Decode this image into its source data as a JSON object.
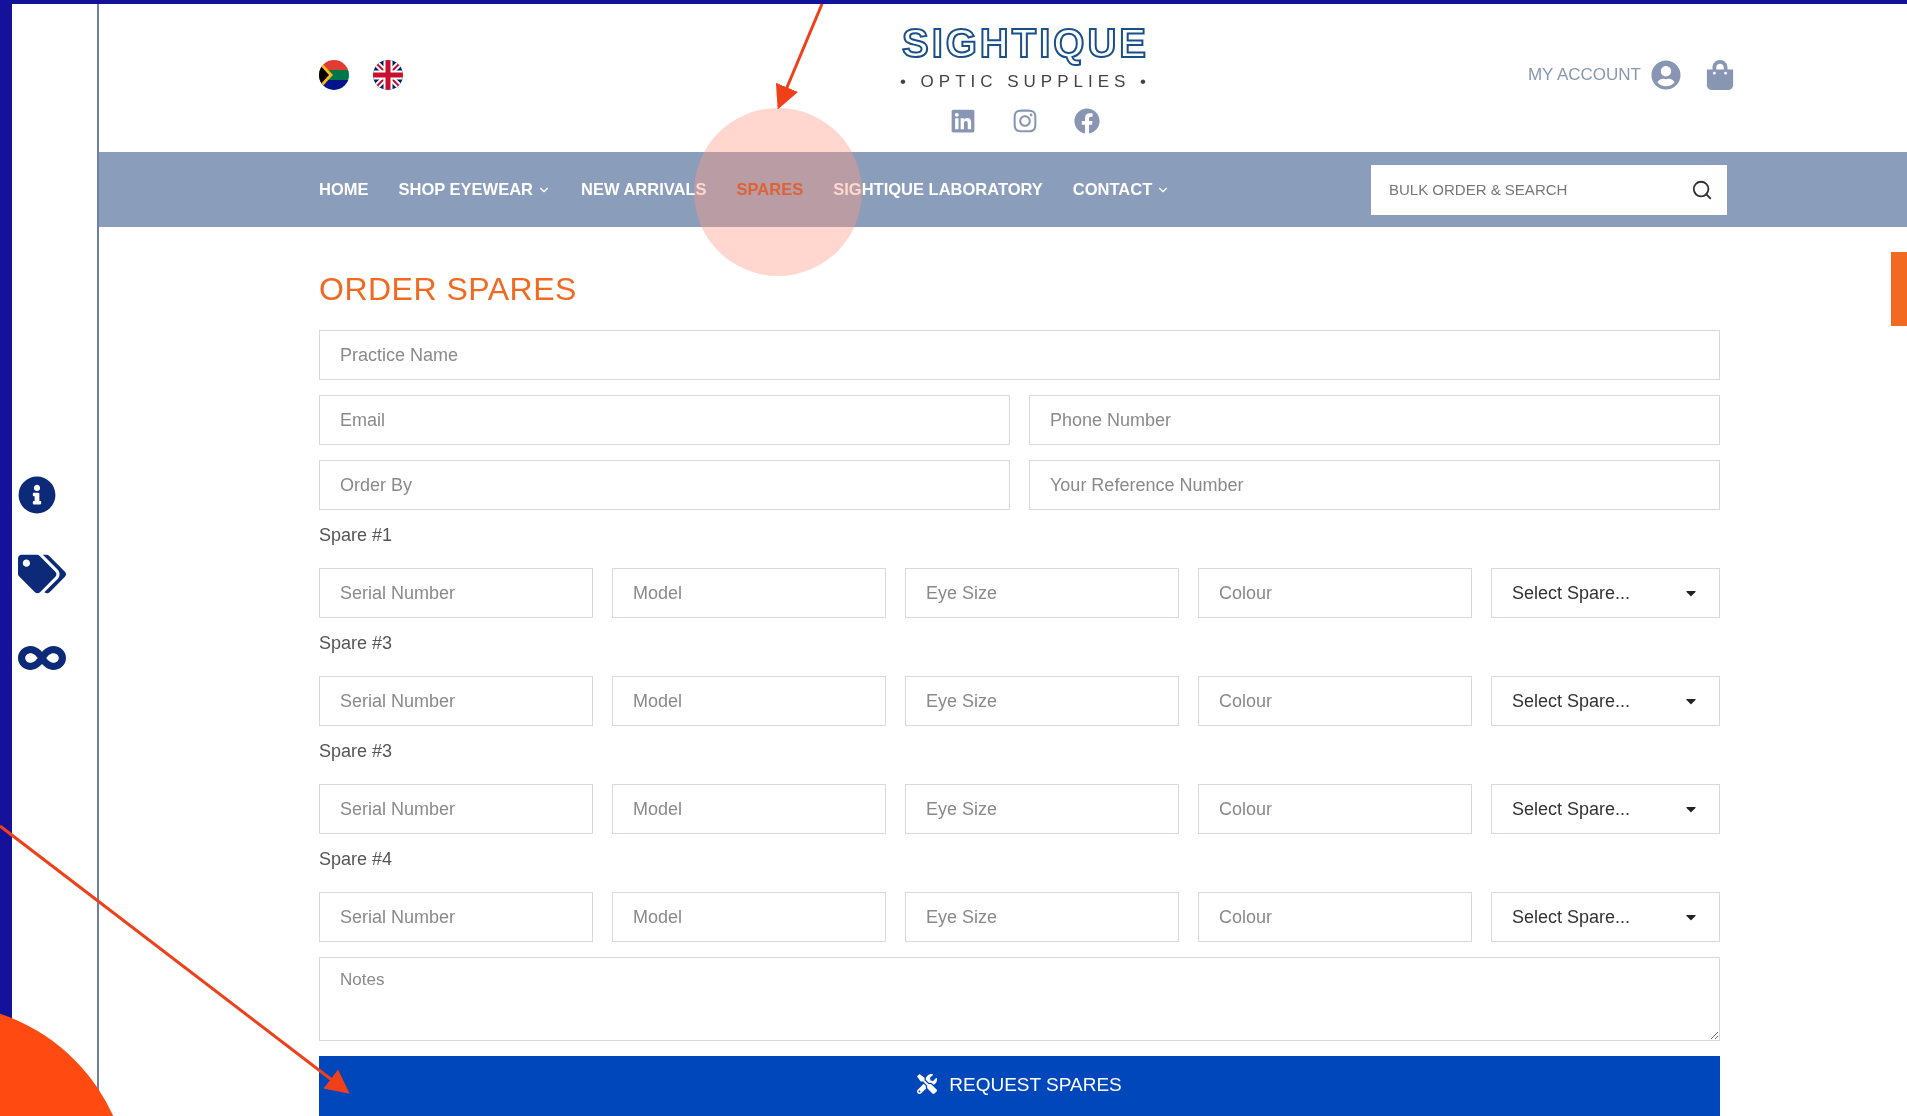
{
  "header": {
    "logo_title": "SIGHTIQUE",
    "logo_subtitle": "• OPTIC SUPPLIES •",
    "account_label": "MY ACCOUNT"
  },
  "nav": {
    "items": [
      {
        "label": "HOME",
        "selected": false,
        "has_menu": false
      },
      {
        "label": "SHOP EYEWEAR",
        "selected": false,
        "has_menu": true
      },
      {
        "label": "NEW ARRIVALS",
        "selected": false,
        "has_menu": false
      },
      {
        "label": "SPARES",
        "selected": true,
        "has_menu": false
      },
      {
        "label": "SIGHTIQUE LABORATORY",
        "selected": false,
        "has_menu": false
      },
      {
        "label": "CONTACT",
        "selected": false,
        "has_menu": true
      }
    ],
    "search": {
      "placeholder": "BULK ORDER & SEARCH"
    }
  },
  "form": {
    "title": "ORDER SPARES",
    "rows": [
      [
        {
          "placeholder": "Practice Name"
        }
      ],
      [
        {
          "placeholder": "Email"
        },
        {
          "placeholder": "Phone Number"
        }
      ],
      [
        {
          "placeholder": "Order By"
        },
        {
          "placeholder": "Your Reference Number"
        }
      ]
    ],
    "spares": [
      {
        "label": "Spare #1",
        "fields": [
          {
            "placeholder": "Serial Number"
          },
          {
            "placeholder": "Model"
          },
          {
            "placeholder": "Eye Size"
          },
          {
            "placeholder": "Colour"
          }
        ],
        "select": "Select Spare..."
      },
      {
        "label": "Spare #3",
        "fields": [
          {
            "placeholder": "Serial Number"
          },
          {
            "placeholder": "Model"
          },
          {
            "placeholder": "Eye Size"
          },
          {
            "placeholder": "Colour"
          }
        ],
        "select": "Select Spare..."
      },
      {
        "label": "Spare #3",
        "fields": [
          {
            "placeholder": "Serial Number"
          },
          {
            "placeholder": "Model"
          },
          {
            "placeholder": "Eye Size"
          },
          {
            "placeholder": "Colour"
          }
        ],
        "select": "Select Spare..."
      },
      {
        "label": "Spare #4",
        "fields": [
          {
            "placeholder": "Serial Number"
          },
          {
            "placeholder": "Model"
          },
          {
            "placeholder": "Eye Size"
          },
          {
            "placeholder": "Colour"
          }
        ],
        "select": "Select Spare..."
      }
    ],
    "notes_placeholder": "Notes",
    "submit": "REQUEST SPARES"
  }
}
